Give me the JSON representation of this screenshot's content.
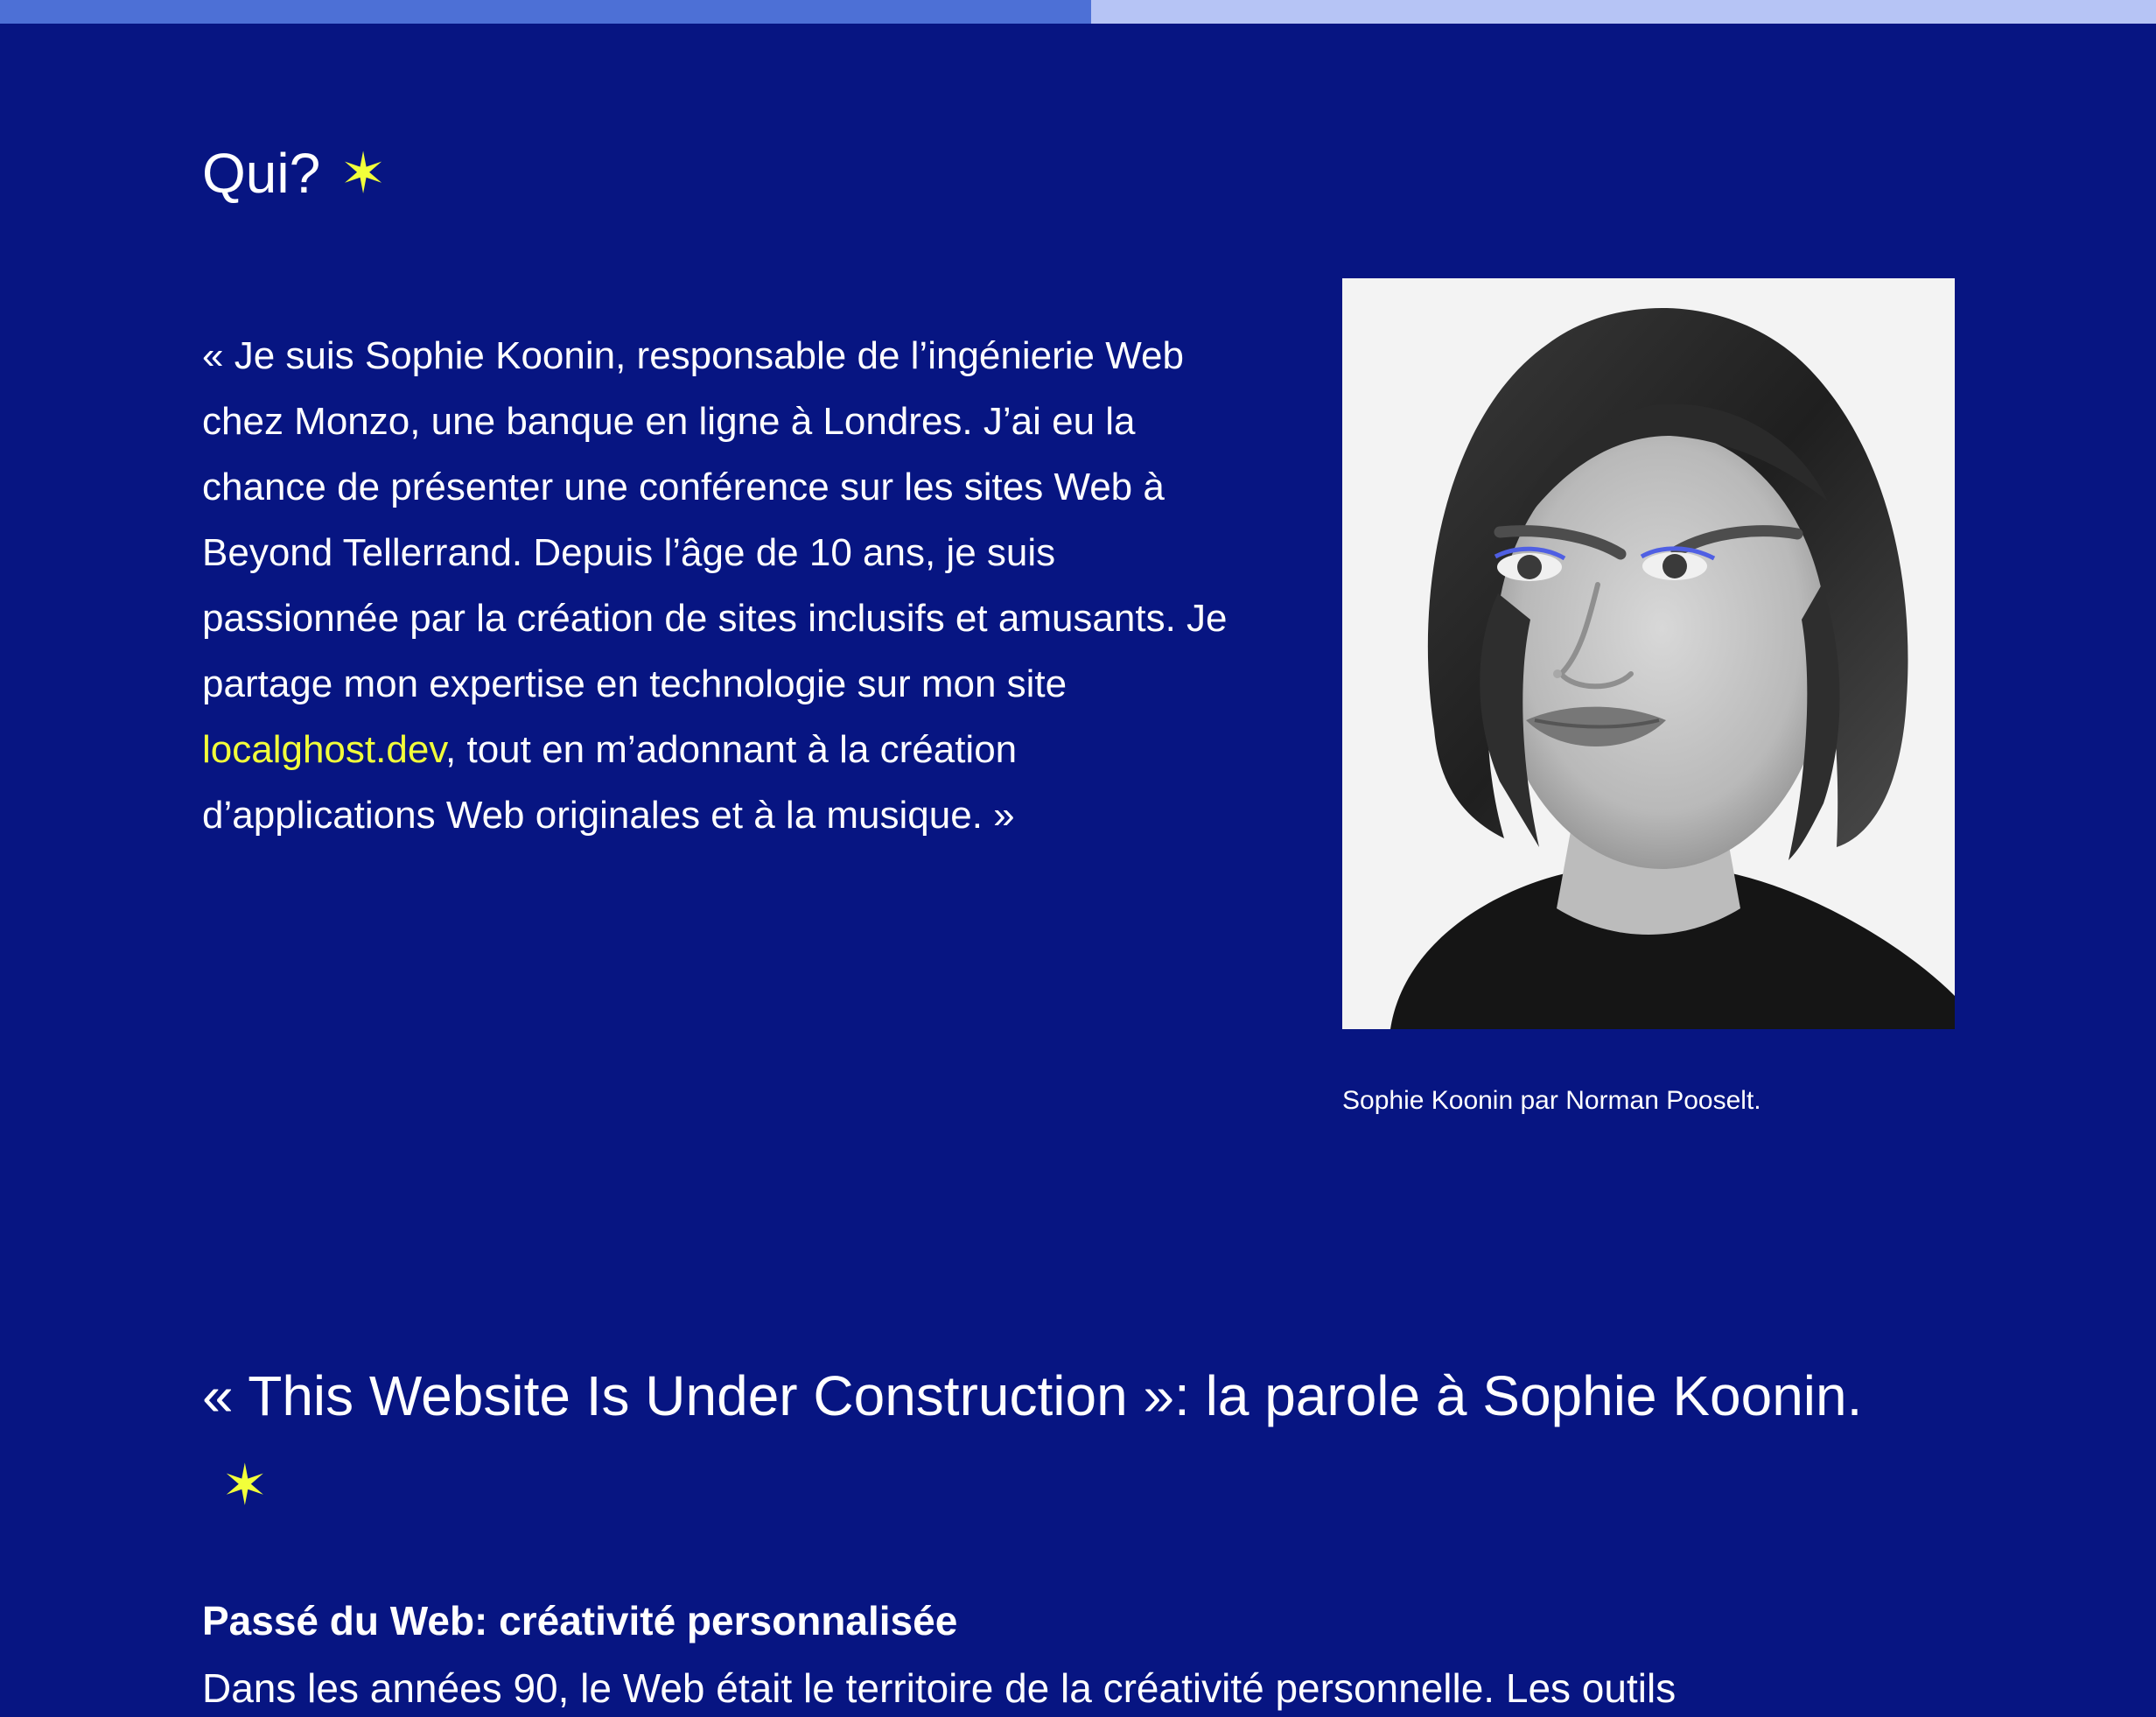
{
  "scroll_progress": 0.506,
  "colors": {
    "background": "#071582",
    "accent_yellow": "#f2ff3a",
    "progress_fill": "#4d70d6",
    "progress_track": "#b6c4f5"
  },
  "who": {
    "title": "Qui?",
    "star": "✶",
    "bio_before_link": "« Je suis Sophie Koonin, responsable de l’ingénierie Web chez Monzo, une banque en ligne à Londres. J’ai eu la chance de présenter une conférence sur les sites Web à Beyond Tellerrand. Depuis l’âge de 10 ans, je suis passionnée par la création de sites inclusifs et amusants. Je partage mon expertise en technologie sur mon site ",
    "bio_link": "localghost.dev",
    "bio_after_link": ", tout en m’adonnant à la création d’applications Web originales et à la musique. »",
    "photo_alt": "Sophie Koonin",
    "photo_caption": "Sophie Koonin par Norman Pooselt."
  },
  "article": {
    "title": "« This Website Is Under Construction »: la parole à Sophie Koonin.",
    "star": "✶",
    "subheading": "Passé du Web: créativité personnalisée",
    "paragraph_start": "Dans les années 90, le Web était le territoire de la créativité personnelle. Les outils"
  }
}
